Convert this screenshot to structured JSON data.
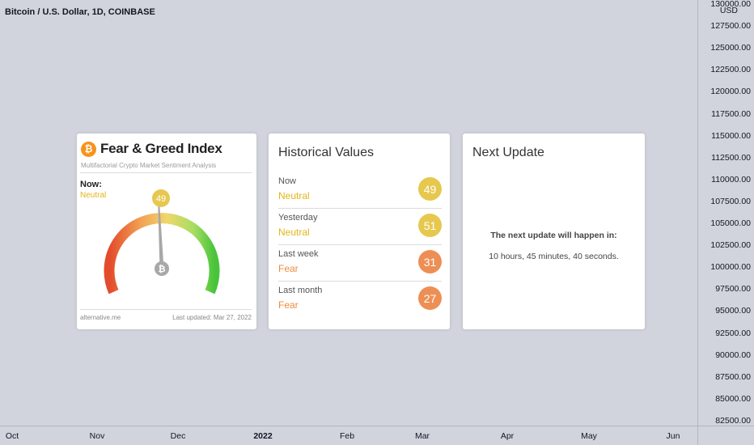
{
  "chart": {
    "title": "Bitcoin / U.S. Dollar, 1D, COINBASE",
    "currency": "USD",
    "price_labels": [
      "130000.00",
      "127500.00",
      "125000.00",
      "122500.00",
      "120000.00",
      "117500.00",
      "115000.00",
      "112500.00",
      "110000.00",
      "107500.00",
      "105000.00",
      "102500.00",
      "100000.00",
      "97500.00",
      "95000.00",
      "92500.00",
      "90000.00",
      "87500.00",
      "85000.00",
      "82500.00"
    ],
    "time_labels": [
      {
        "text": "Oct",
        "bold": false
      },
      {
        "text": "Nov",
        "bold": false
      },
      {
        "text": "Dec",
        "bold": false
      },
      {
        "text": "2022",
        "bold": true
      },
      {
        "text": "Feb",
        "bold": false
      },
      {
        "text": "Mar",
        "bold": false
      },
      {
        "text": "Apr",
        "bold": false
      },
      {
        "text": "May",
        "bold": false
      },
      {
        "text": "Jun",
        "bold": false
      }
    ]
  },
  "fear_greed": {
    "logo_glyph": "₿",
    "title": "Fear & Greed Index",
    "subtitle": "Multifactorial Crypto Market Sentiment Analysis",
    "now_label": "Now:",
    "now_value": "Neutral",
    "now_value_color": "#e3b619",
    "gauge_value": 49,
    "gauge_badge_text": "49",
    "gauge_center_glyph": "₿",
    "source": "alternative.me",
    "last_updated": "Last updated: Mar 27, 2022"
  },
  "historical": {
    "title": "Historical Values",
    "rows": [
      {
        "label": "Now",
        "classification": "Neutral",
        "value": "49",
        "color": "#e3b619",
        "badge_color": "#e6c84f"
      },
      {
        "label": "Yesterday",
        "classification": "Neutral",
        "value": "51",
        "color": "#e3b619",
        "badge_color": "#e6c84f"
      },
      {
        "label": "Last week",
        "classification": "Fear",
        "value": "31",
        "color": "#ed8b3f",
        "badge_color": "#ed8f55"
      },
      {
        "label": "Last month",
        "classification": "Fear",
        "value": "27",
        "color": "#ed8b3f",
        "badge_color": "#ed8f55"
      }
    ]
  },
  "next_update": {
    "title": "Next Update",
    "message": "The next update will happen in:",
    "countdown": "10 hours, 45 minutes, 40 seconds."
  }
}
